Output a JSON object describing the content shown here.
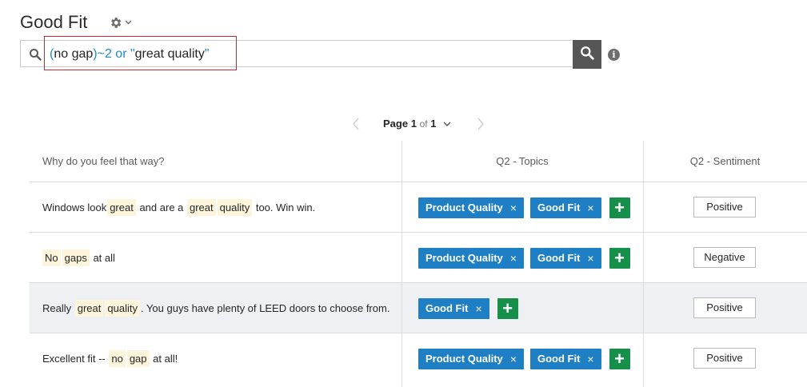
{
  "header": {
    "title": "Good Fit",
    "gear_icon": "gear-icon",
    "chevron_icon": "chevron-down-icon"
  },
  "search": {
    "query_parts": {
      "open_paren": "(",
      "term1": "no gap",
      "close_paren": ")",
      "proximity": "~2",
      "operator": " or ",
      "quote_open": "\"",
      "term2": "great quality",
      "quote_close": "\""
    },
    "icon": "search-icon",
    "button_icon": "search-icon",
    "info_label": "i"
  },
  "pager": {
    "page_label": "Page",
    "current": "1",
    "of_label": "of",
    "total": "1"
  },
  "columns": {
    "response": "Why do you feel that way?",
    "topics": "Q2 - Topics",
    "sentiment": "Q2 - Sentiment"
  },
  "rows": [
    {
      "text_parts": [
        "Windows look ",
        "great",
        " and are a ",
        "great",
        " ",
        "quality",
        " too. Win win."
      ],
      "topics": [
        "Product Quality",
        "Good Fit"
      ],
      "sentiment": "Positive"
    },
    {
      "text_parts": [
        "",
        "No",
        " ",
        "gaps",
        " at all"
      ],
      "topics": [
        "Product Quality",
        "Good Fit"
      ],
      "sentiment": "Negative"
    },
    {
      "text_parts": [
        "Really ",
        "great",
        " ",
        "quality",
        ". You guys have plenty of LEED doors to choose from."
      ],
      "topics": [
        "Good Fit"
      ],
      "sentiment": "Positive"
    },
    {
      "text_parts": [
        "Excellent fit -- ",
        "no",
        " ",
        "gap",
        " at all!"
      ],
      "topics": [
        "Product Quality",
        "Good Fit"
      ],
      "sentiment": "Positive"
    }
  ],
  "tag_remove_glyph": "×",
  "add_glyph": "+",
  "colors": {
    "tag_blue": "#1f7fc5",
    "add_green": "#168f4a",
    "highlight": "#fdf5db",
    "query_blue": "#1b8cc9",
    "annotation_red": "#c62a2f",
    "search_button": "#565656"
  }
}
